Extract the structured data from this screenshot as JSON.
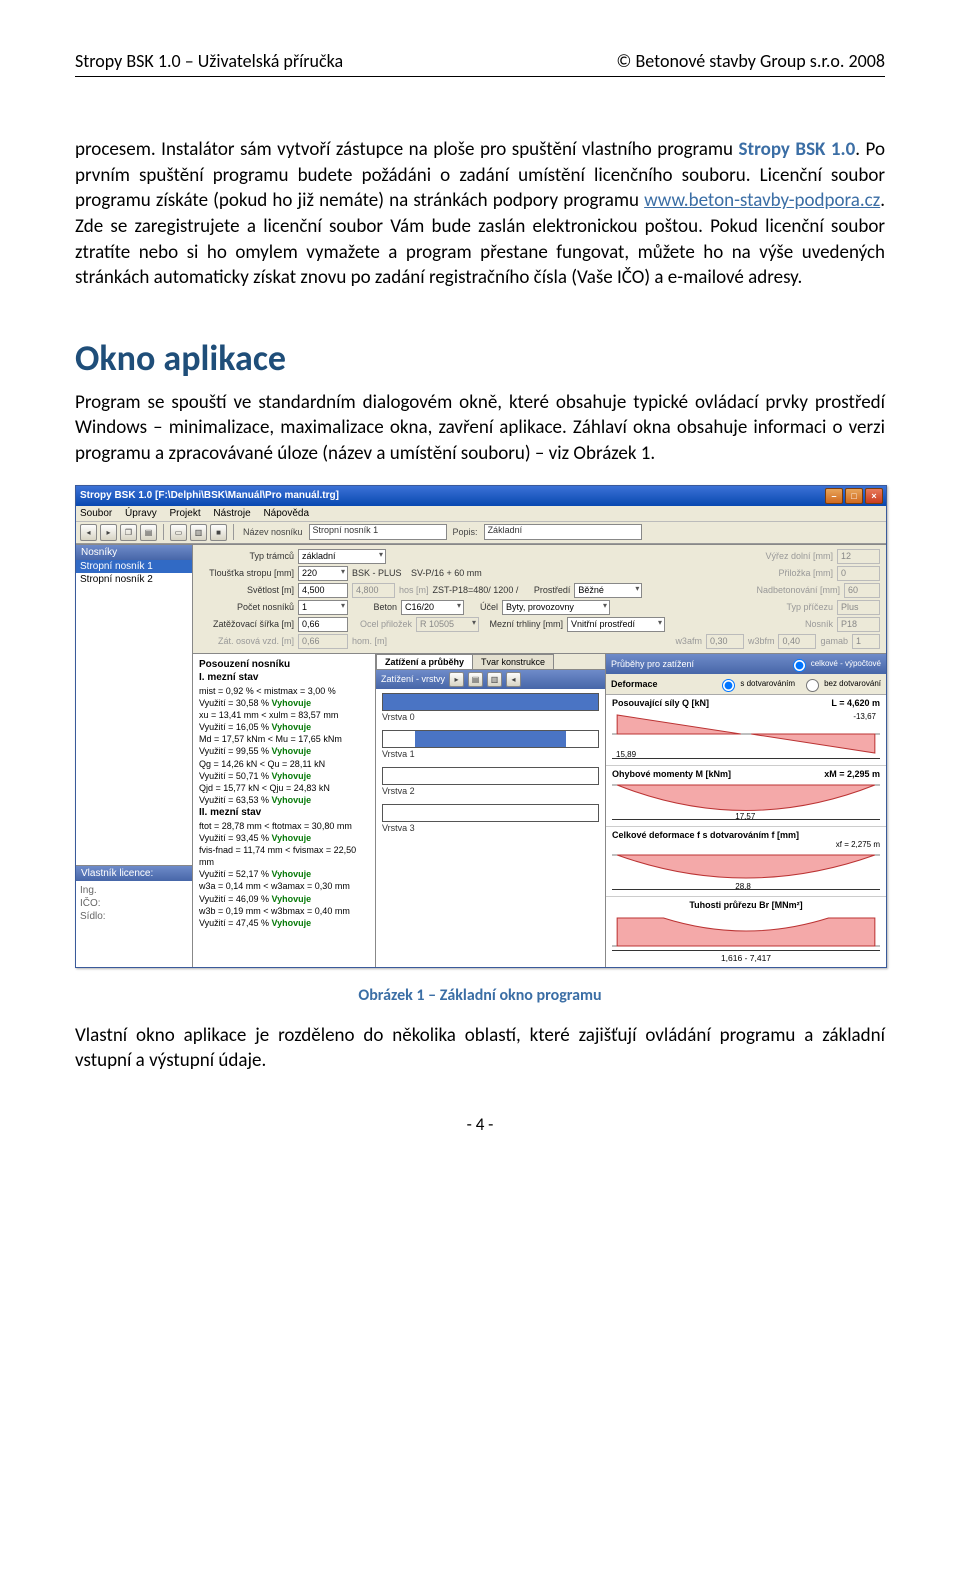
{
  "header": {
    "left": "Stropy BSK 1.0 – Uživatelská příručka",
    "right": "© Betonové stavby Group s.r.o. 2008"
  },
  "para1a": "procesem. Instalátor sám vytvoří zástupce na ploše pro spuštění vlastního programu ",
  "brand": "Stropy BSK 1.0",
  "para1b": ". Po prvním spuštění programu budete požádáni o zadání umístění licenčního souboru. Licenční soubor programu získáte (pokud ho již nemáte) na stránkách podpory programu ",
  "link": "www.beton-stavby-podpora.cz",
  "para1c": ". Zde se zaregistrujete a licenční soubor Vám bude zaslán elektronickou poštou. Pokud licenční soubor ztratíte nebo si ho omylem vymažete a program přestane fungovat, můžete ho na výše uvedených stránkách automaticky získat znovu po zadání registračního čísla (Vaše IČO) a e-mailové adresy.",
  "h2": "Okno aplikace",
  "para2": "Program se spouští ve standardním dialogovém okně, které obsahuje typické ovládací prvky prostředí Windows – minimalizace, maximalizace okna, zavření aplikace. Záhlaví okna obsahuje informaci o verzi programu a zpracovávané úloze (název a umístění souboru) – viz Obrázek 1.",
  "caption": "Obrázek 1 – Základní okno programu",
  "para3": "Vlastní okno aplikace je rozděleno do několika oblastí, které zajišťují ovládání programu a základní vstupní a výstupní údaje.",
  "pagenum": "- 4 -",
  "app": {
    "title": "Stropy BSK 1.0 [F:\\Delphi\\BSK\\Manuál\\Pro manuál.trg]",
    "menu": {
      "soubor": "Soubor",
      "upravy": "Úpravy",
      "projekt": "Projekt",
      "nastroje": "Nástroje",
      "napoveda": "Nápověda"
    },
    "toolbar": {
      "nazev_lbl": "Název nosníku",
      "nazev_val": "Stropní nosník 1",
      "popis_lbl": "Popis:",
      "popis_val": "Základní"
    },
    "left": {
      "head": "Nosníky",
      "items": [
        "Stropní nosník 1",
        "Stropní nosník 2"
      ],
      "lic_head": "Vlastník licence:",
      "lic_lines": [
        "Ing.",
        "IČO:",
        "Sídlo:"
      ]
    },
    "form": {
      "r1": {
        "l1": "Typ trámců",
        "v1": "základní",
        "l2": "Výřez dolní [mm]",
        "v2": "12"
      },
      "r2": {
        "l1": "Tloušťka stropu [mm]",
        "v1": "220",
        "m1": "BSK - PLUS",
        "m2": "SV-P/16 + 60 mm",
        "l2": "Přiložka [mm]",
        "v2": "0"
      },
      "r3": {
        "l1": "Světlost [m]",
        "v1": "4,500",
        "g1": "4,800",
        "g2": "hos [m]",
        "m1": "ZST-P18=480/ 1200 /",
        "l2": "Prostředí",
        "v2": "Běžné",
        "l3": "Nadbetonování [mm]",
        "v3": "60"
      },
      "r4": {
        "l1": "Počet nosníků",
        "v1": "1",
        "l2": "Beton",
        "v2": "C16/20",
        "l3": "Účel",
        "v3": "Byty, provozovny",
        "l4": "Typ příčezu",
        "v4": "Plus"
      },
      "r5": {
        "l1": "Zatěžovací šířka [m]",
        "v1": "0,66",
        "l2": "Ocel přiložek",
        "v2": "R 10505",
        "l3": "Mezní trhliny [mm]",
        "v3": "Vnitřní prostředí",
        "l4": "Nosník",
        "v4": "P18"
      },
      "r6": {
        "l1": "Zát. osová vzd. [m]",
        "v1": "0,66",
        "g1": "hom. [m]",
        "l2": "w3afm",
        "v2": "0,30",
        "l3": "w3bfm",
        "v3": "0,40",
        "l4": "gamab",
        "v4": "1"
      }
    },
    "assess": {
      "title": "Posouzení nosníku",
      "s1": "I. mezní stav",
      "l1a": "mist = 0,92 % < mistmax = 3,00 %",
      "l1b": "Využití = 30,58 % ",
      "l2a": "xu = 13,41 mm < xulm = 83,57 mm",
      "l2b": "Využití = 16,05 % ",
      "l3a": "Md = 17,57 kNm < Mu = 17,65 kNm",
      "l3b": "Využití = 99,55 % ",
      "l4a": "Qg = 14,26 kN < Qu = 28,11 kN",
      "l4b": "Využití = 50,71 % ",
      "l5a": "Qjd = 15,77 kN < Qju = 24,83 kN",
      "l5b": "Využití = 63,53 % ",
      "s2": "II. mezní stav",
      "l6a": "ftot = 28,78 mm < ftotmax = 30,80 mm",
      "l6b": "Využití = 93,45 % ",
      "l7a": "fvis-fnad = 11,74 mm < fvismax = 22,50 mm",
      "l7b": "Využití = 52,17 % ",
      "l8a": "w3a = 0,14 mm < w3amax = 0,30 mm",
      "l8b": "Využití = 46,09 % ",
      "l9a": "w3b = 0,19 mm < w3bmax = 0,40 mm",
      "l9b": "Využití = 47,45 % ",
      "ok": "Vyhovuje"
    },
    "tabs": {
      "t1": "Zatížení a průběhy",
      "t2": "Tvar konstrukce"
    },
    "layers": {
      "head": "Zatížení - vrstvy",
      "names": [
        "Vrstva 0",
        "Vrstva 1",
        "Vrstva 2",
        "Vrstva 3"
      ]
    },
    "charts": {
      "head": "Průběhy pro zatížení",
      "opt1": "celkové - výpočtové",
      "row2l": "Deformace",
      "row2a": "s dotvarováním",
      "row2b": "bez dotvarování",
      "c1": {
        "title": "Posouvající síly Q [kN]",
        "L": "L = 4,620 m",
        "left": "15,89",
        "right": "-13,67"
      },
      "c2": {
        "title": "Ohybové momenty M [kNm]",
        "xm": "xM = 2,295 m",
        "val": "17,57"
      },
      "c3": {
        "title": "Celkové deformace f s dotvarováním f [mm]",
        "xf": "xf = 2,275 m",
        "val": "28,8"
      },
      "c4": {
        "title": "Tuhosti průřezu Br [MNm²]",
        "range": "1,616 - 7,417"
      }
    }
  }
}
